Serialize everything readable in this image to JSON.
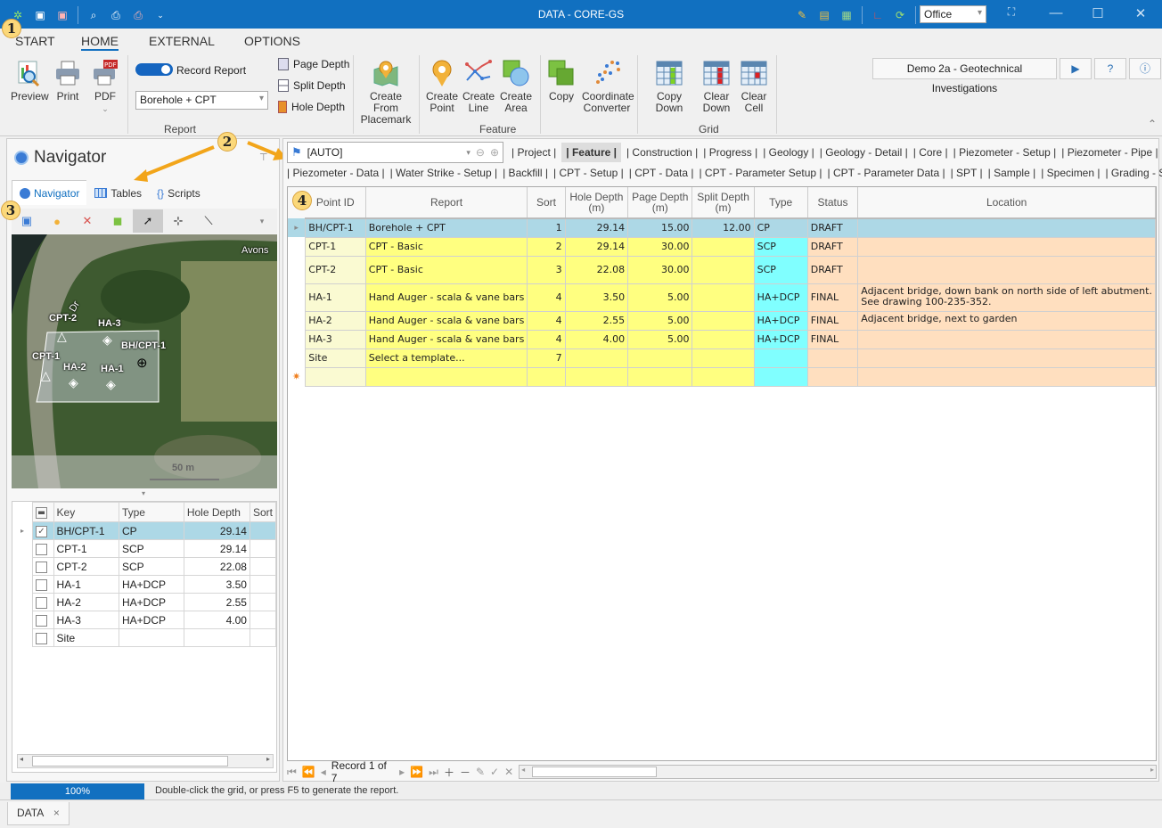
{
  "window": {
    "title": "DATA - CORE-GS",
    "theme": "Office"
  },
  "ribbon": {
    "tabs": [
      "START",
      "HOME",
      "EXTERNAL",
      "OPTIONS"
    ],
    "active_tab": "HOME",
    "project_button": "Demo 2a - Geotechnical Investigations",
    "report_group": {
      "label": "Report",
      "preview": "Preview",
      "print": "Print",
      "pdf": "PDF",
      "record_report": "Record Report",
      "record_report_on": true,
      "report_template": "Borehole + CPT",
      "page_depth": "Page Depth",
      "split_depth": "Split Depth",
      "hole_depth": "Hole Depth"
    },
    "feature_group": {
      "label": "Feature",
      "create_from_placemark": [
        "Create From",
        "Placemark"
      ],
      "create_point": [
        "Create",
        "Point"
      ],
      "create_line": [
        "Create",
        "Line"
      ],
      "create_area": [
        "Create",
        "Area"
      ],
      "copy": "Copy",
      "coordinate_converter": [
        "Coordinate",
        "Converter"
      ]
    },
    "grid_group": {
      "label": "Grid",
      "copy_down": "Copy Down",
      "clear_down": [
        "Clear",
        "Down"
      ],
      "clear_cell": [
        "Clear",
        "Cell"
      ]
    }
  },
  "navigator": {
    "title": "Navigator",
    "tabs": [
      "Navigator",
      "Tables",
      "Scripts"
    ],
    "map": {
      "place_label": "Avons",
      "road_label": "Dr",
      "scale": "50 m",
      "features": [
        "CPT-2",
        "HA-3",
        "BH/CPT-1",
        "CPT-1",
        "HA-2",
        "HA-1"
      ]
    },
    "grid": {
      "columns": [
        "Key",
        "Type",
        "Hole Depth",
        "Sort"
      ],
      "rows": [
        {
          "checked": true,
          "key": "BH/CPT-1",
          "type": "CP",
          "depth": "29.14"
        },
        {
          "checked": false,
          "key": "CPT-1",
          "type": "SCP",
          "depth": "29.14"
        },
        {
          "checked": false,
          "key": "CPT-2",
          "type": "SCP",
          "depth": "22.08"
        },
        {
          "checked": false,
          "key": "HA-1",
          "type": "HA+DCP",
          "depth": "3.50"
        },
        {
          "checked": false,
          "key": "HA-2",
          "type": "HA+DCP",
          "depth": "2.55"
        },
        {
          "checked": false,
          "key": "HA-3",
          "type": "HA+DCP",
          "depth": "4.00"
        },
        {
          "checked": false,
          "key": "Site",
          "type": "",
          "depth": ""
        }
      ]
    }
  },
  "table_selector": {
    "value": "[AUTO]"
  },
  "table_tabs_row1": [
    "| Project |",
    "| Feature |",
    "| Construction |",
    "| Progress |",
    "| Geology |",
    "| Geology - Detail |",
    "| Core |",
    "| Piezometer - Setup |",
    "| Piezometer - Pipe |"
  ],
  "table_tabs_row2": [
    "| Piezometer - Data |",
    "| Water Strike - Setup |",
    "| Backfill |",
    "| CPT - Setup |",
    "| CPT - Data |",
    "| CPT - Parameter Setup |",
    "| CPT - Parameter Data |",
    "| SPT |",
    "| Sample |",
    "| Specimen |",
    "| Grading - Setup |"
  ],
  "active_table": "| Feature |",
  "main_grid": {
    "columns": [
      "Point ID",
      "Report",
      "Sort",
      "Hole Depth\n(m)",
      "Page Depth\n(m)",
      "Split Depth\n(m)",
      "Type",
      "Status",
      "Location"
    ],
    "rows": [
      {
        "id": "BH/CPT-1",
        "report": "Borehole + CPT",
        "sort": "1",
        "hole": "29.14",
        "page": "15.00",
        "split": "12.00",
        "type": "CP",
        "status": "DRAFT",
        "loc": ""
      },
      {
        "id": "CPT-1",
        "report": "CPT - Basic",
        "sort": "2",
        "hole": "29.14",
        "page": "30.00",
        "split": "",
        "type": "SCP",
        "status": "DRAFT",
        "loc": ""
      },
      {
        "id": "CPT-2",
        "report": "CPT - Basic",
        "sort": "3",
        "hole": "22.08",
        "page": "30.00",
        "split": "",
        "type": "SCP",
        "status": "DRAFT",
        "loc": ""
      },
      {
        "id": "HA-1",
        "report": "Hand Auger - scala & vane bars",
        "sort": "4",
        "hole": "3.50",
        "page": "5.00",
        "split": "",
        "type": "HA+DCP",
        "status": "FINAL",
        "loc": "Adjacent bridge, down bank on north side of left abutment.\nSee drawing 100-235-352."
      },
      {
        "id": "HA-2",
        "report": "Hand Auger - scala & vane bars",
        "sort": "4",
        "hole": "2.55",
        "page": "5.00",
        "split": "",
        "type": "HA+DCP",
        "status": "FINAL",
        "loc": "Adjacent bridge, next to garden"
      },
      {
        "id": "HA-3",
        "report": "Hand Auger - scala & vane bars",
        "sort": "4",
        "hole": "4.00",
        "page": "5.00",
        "split": "",
        "type": "HA+DCP",
        "status": "FINAL",
        "loc": ""
      },
      {
        "id": "Site",
        "report": "Select a template...",
        "sort": "7",
        "hole": "",
        "page": "",
        "split": "",
        "type": "",
        "status": "",
        "loc": ""
      }
    ],
    "record_nav": "Record 1 of 7"
  },
  "status": {
    "progress_label": "100%",
    "progress": 1.0,
    "message": "Double-click the grid, or press F5 to generate the report."
  },
  "doc_tab": {
    "label": "DATA",
    "close": "×"
  },
  "callouts": [
    "1",
    "2",
    "3",
    "4"
  ]
}
